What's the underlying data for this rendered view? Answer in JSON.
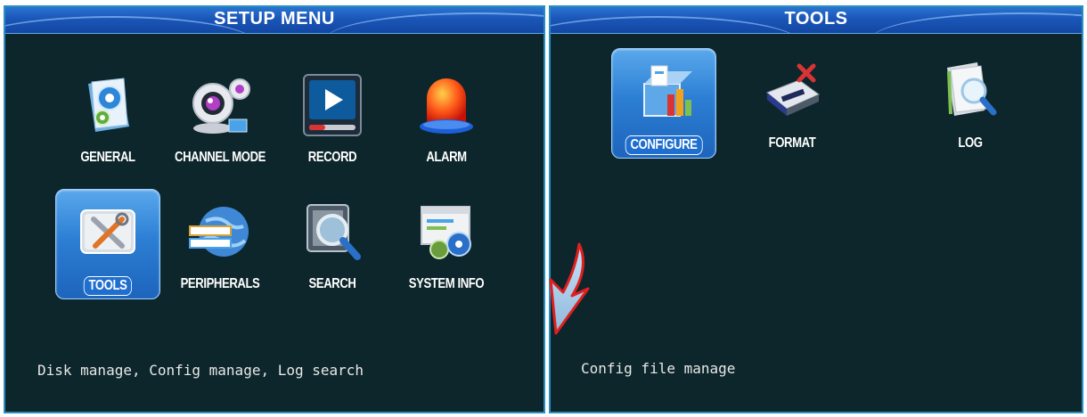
{
  "setup_menu": {
    "title": "SETUP  MENU",
    "items": [
      {
        "label": "GENERAL",
        "icon": "general-settings-icon"
      },
      {
        "label": "CHANNEL MODE",
        "icon": "webcam-icon"
      },
      {
        "label": "RECORD",
        "icon": "record-player-icon"
      },
      {
        "label": "ALARM",
        "icon": "alarm-siren-icon"
      },
      {
        "label": "TOOLS",
        "icon": "tools-icon",
        "selected": true
      },
      {
        "label": "PERIPHERALS",
        "icon": "globe-peripherals-icon"
      },
      {
        "label": "SEARCH",
        "icon": "search-magnifier-icon"
      },
      {
        "label": "SYSTEM INFO",
        "icon": "system-info-gears-icon"
      }
    ],
    "status": "Disk manage, Config manage, Log search"
  },
  "tools_menu": {
    "title": "TOOLS",
    "items": [
      {
        "label": "CONFIGURE",
        "icon": "configure-icon",
        "selected": true
      },
      {
        "label": "FORMAT",
        "icon": "format-disk-icon"
      },
      {
        "label": "LOG",
        "icon": "log-search-icon"
      }
    ],
    "status": "Config file manage"
  },
  "colors": {
    "panel_bg": "#0d262b",
    "titlebar": "#1a56b8",
    "selection": "#2c7fd4",
    "arrow": "#e02020"
  }
}
